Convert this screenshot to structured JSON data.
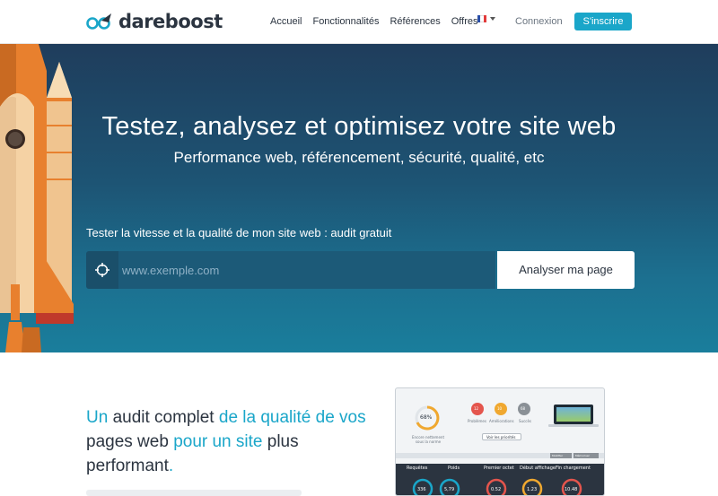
{
  "brand": {
    "name": "dareboost",
    "accent": "#1aa6c9",
    "dark": "#2b3440"
  },
  "nav": {
    "links": [
      "Accueil",
      "Fonctionnalités",
      "Références",
      "Offres"
    ],
    "language_icon": "flag-fr-icon",
    "login": "Connexion",
    "signup": "S'inscrire"
  },
  "hero": {
    "title": "Testez, analysez et optimisez votre site web",
    "subtitle": "Performance web, référencement, sécurité, qualité, etc",
    "test_label": "Tester la vitesse et la qualité de mon site web : audit gratuit",
    "search_placeholder": "www.exemple.com",
    "search_icon": "crosshair-icon",
    "analyze_label": "Analyser ma page"
  },
  "content": {
    "headline": [
      {
        "text": "Un",
        "style": "accent"
      },
      {
        "text": " audit complet ",
        "style": "dark"
      },
      {
        "text": "de la qualité de vos",
        "style": "accent"
      },
      {
        "text": " pages web ",
        "style": "dark"
      },
      {
        "text": "pour un site",
        "style": "accent"
      },
      {
        "text": " plus performant",
        "style": "dark"
      },
      {
        "text": ".",
        "style": "accent"
      }
    ]
  },
  "report_preview": {
    "score": "68%",
    "score_caption": "Encore nettement sous la norme",
    "badges": [
      {
        "value": "12",
        "label": "Problèmes",
        "color": "#e4554d"
      },
      {
        "value": "10",
        "label": "Améliorations",
        "color": "#f0a830"
      },
      {
        "value": "68",
        "label": "Succès",
        "color": "#8a9096"
      }
    ],
    "priorities_button": "Voir les priorités",
    "metrics_bar_buttons": [
      "Modifier",
      "Mémoriser"
    ],
    "metrics": [
      {
        "label": "Requêtes",
        "value": "336"
      },
      {
        "label": "Poids",
        "value": "5,79"
      },
      {
        "label": "Premier octet",
        "value": "0.52"
      },
      {
        "label": "Début affichage",
        "value": "1.23"
      },
      {
        "label": "Fin chargement",
        "value": "10.48"
      }
    ]
  }
}
